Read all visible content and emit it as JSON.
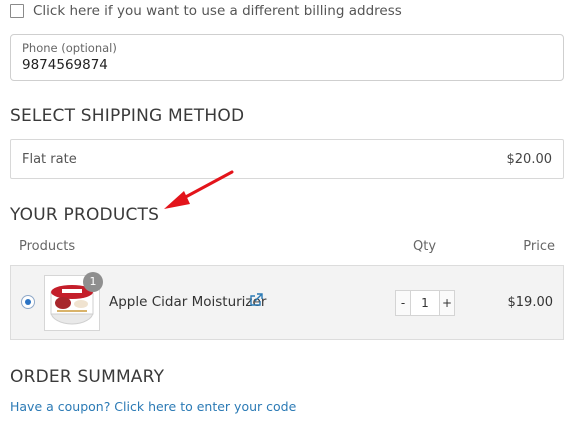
{
  "billing": {
    "checkbox_label": "Click here if you want to use a different billing address",
    "checked": false
  },
  "phone": {
    "label": "Phone (optional)",
    "value": "9874569874"
  },
  "shipping": {
    "heading": "SELECT SHIPPING METHOD",
    "method_name": "Flat rate",
    "method_price": "$20.00"
  },
  "products": {
    "heading": "YOUR PRODUCTS",
    "columns": {
      "products": "Products",
      "qty": "Qty",
      "price": "Price"
    },
    "items": [
      {
        "name": "Apple Cidar Moisturizer",
        "quantity": "1",
        "badge_count": "1",
        "price": "$19.00",
        "selected": true,
        "stepper_minus": "-",
        "stepper_plus": "+"
      }
    ]
  },
  "summary": {
    "heading": "ORDER SUMMARY",
    "coupon_link": "Have a coupon? Click here to enter your code"
  },
  "colors": {
    "annotation_arrow": "#e3141b",
    "link": "#2b7ab5",
    "radio_selected": "#2b73c4",
    "row_background": "#f3f3f3"
  }
}
